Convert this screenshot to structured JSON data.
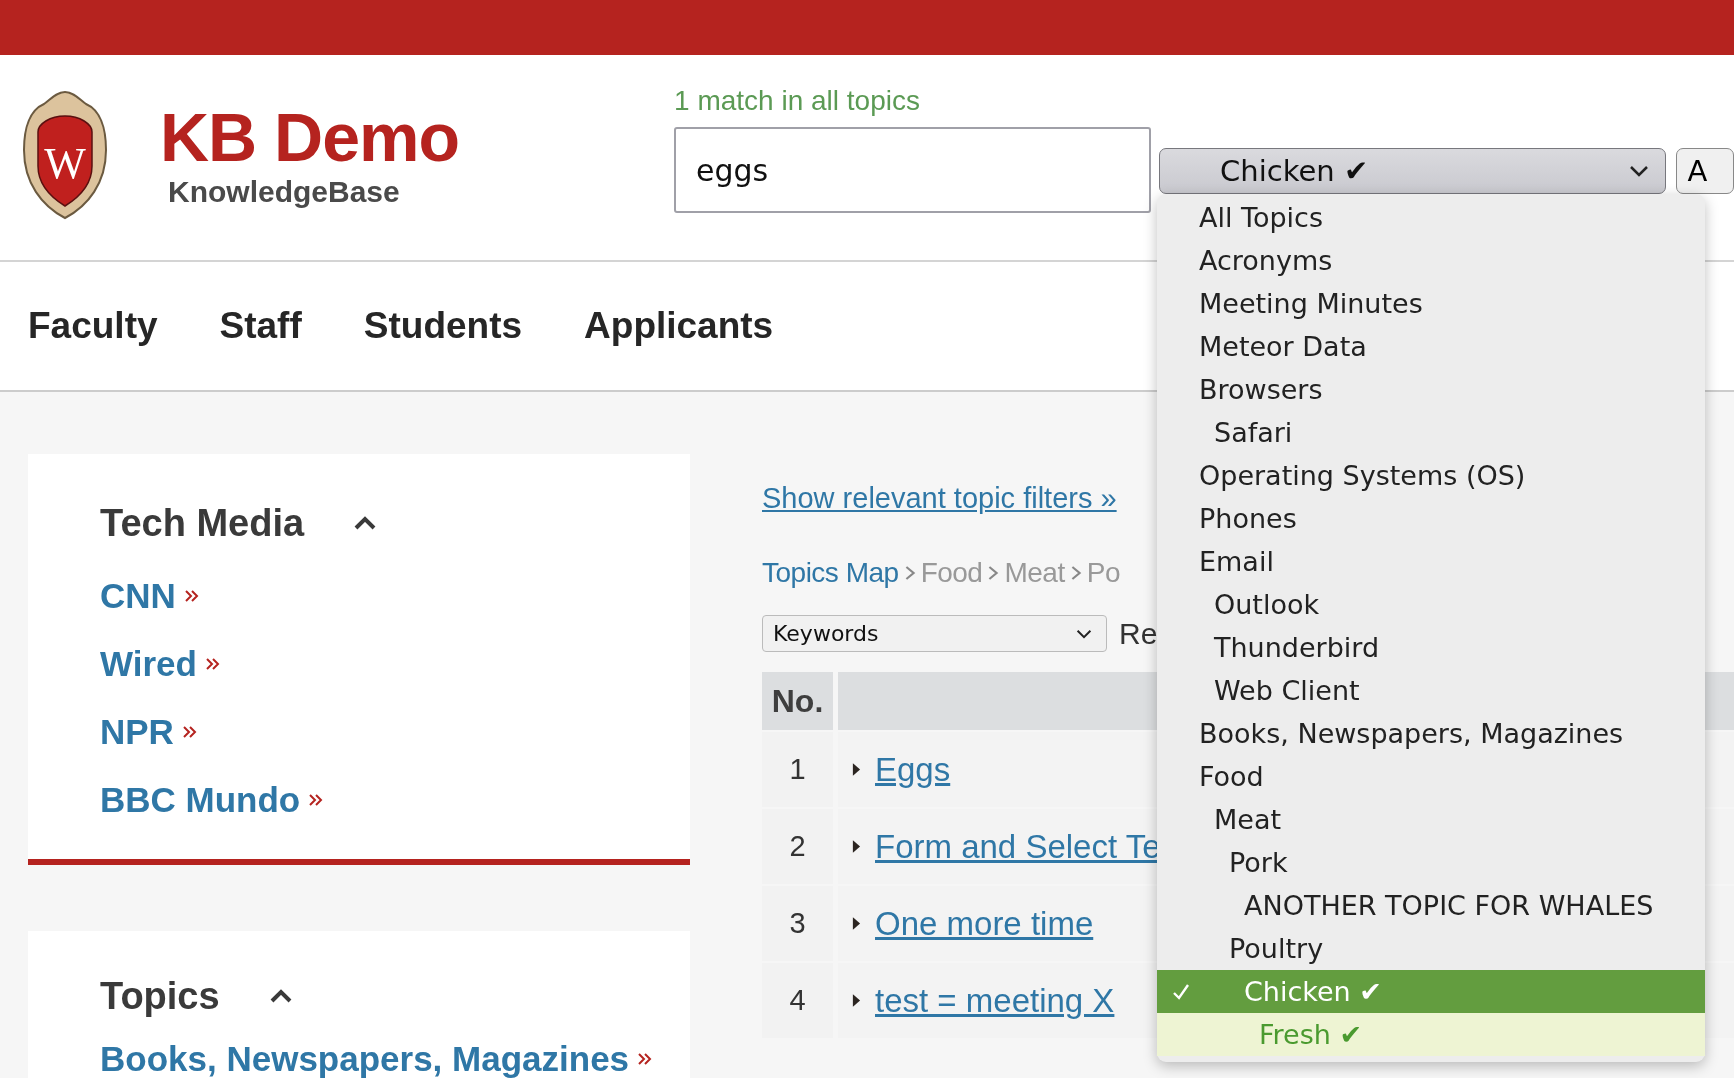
{
  "logo": {
    "letter": "W",
    "title": "KB Demo",
    "subtitle": "KnowledgeBase"
  },
  "search": {
    "match_text": "1 match in all topics",
    "value": "eggs"
  },
  "topic_select": {
    "value": "Chicken ✔"
  },
  "side_button": {
    "label": "A"
  },
  "nav": [
    "Faculty",
    "Staff",
    "Students",
    "Applicants"
  ],
  "sidebar": [
    {
      "title": "Tech Media",
      "expanded": true,
      "links": [
        "CNN",
        "Wired",
        "NPR",
        "BBC Mundo"
      ]
    },
    {
      "title": "Topics",
      "expanded": true,
      "links": [
        "Books, Newspapers, Magazines"
      ]
    }
  ],
  "filters_link": "Show relevant topic filters »",
  "breadcrumb": [
    {
      "label": "Topics Map",
      "kind": "link"
    },
    {
      "label": "Food",
      "kind": "plain"
    },
    {
      "label": "Meat",
      "kind": "plain"
    },
    {
      "label": "Po",
      "kind": "plain"
    }
  ],
  "sort_select": {
    "value": "Keywords"
  },
  "results_label": "Re",
  "table": {
    "columns": [
      "No."
    ],
    "rows": [
      {
        "no": "1",
        "title": "Eggs"
      },
      {
        "no": "2",
        "title": "Form and Select Te"
      },
      {
        "no": "3",
        "title": "One more time"
      },
      {
        "no": "4",
        "title": "test = meeting X"
      }
    ]
  },
  "topic_menu": {
    "options": [
      {
        "label": "All Topics",
        "selected": false,
        "highlighted": false
      },
      {
        "label": "Acronyms",
        "selected": false,
        "highlighted": false
      },
      {
        "label": "Meeting Minutes",
        "selected": false,
        "highlighted": false
      },
      {
        "label": "Meteor Data",
        "selected": false,
        "highlighted": false
      },
      {
        "label": "Browsers",
        "selected": false,
        "highlighted": false,
        "children": [
          {
            "label": "Safari",
            "selected": false,
            "highlighted": false
          }
        ]
      },
      {
        "label": "Operating Systems (OS)",
        "selected": false,
        "highlighted": false
      },
      {
        "label": "Phones",
        "selected": false,
        "highlighted": false
      },
      {
        "label": "Email",
        "selected": false,
        "highlighted": false,
        "children": [
          {
            "label": "Outlook",
            "selected": false,
            "highlighted": false
          },
          {
            "label": "Thunderbird",
            "selected": false,
            "highlighted": false
          },
          {
            "label": "Web Client",
            "selected": false,
            "highlighted": false
          }
        ]
      },
      {
        "label": "Books, Newspapers, Magazines",
        "selected": false,
        "highlighted": false
      },
      {
        "label": "Food",
        "selected": false,
        "highlighted": false,
        "children": [
          {
            "label": "Meat",
            "selected": false,
            "highlighted": false,
            "children": [
              {
                "label": "Pork",
                "selected": false,
                "highlighted": false,
                "children": [
                  {
                    "label": "ANOTHER TOPIC FOR WHALES",
                    "selected": false,
                    "highlighted": false
                  }
                ]
              },
              {
                "label": "Poultry",
                "selected": false,
                "highlighted": false,
                "children": [
                  {
                    "label": "Chicken ✔",
                    "selected": true,
                    "highlighted": false,
                    "children": [
                      {
                        "label": "Fresh ✔",
                        "selected": false,
                        "highlighted": true
                      }
                    ]
                  }
                ]
              }
            ]
          }
        ]
      }
    ]
  }
}
